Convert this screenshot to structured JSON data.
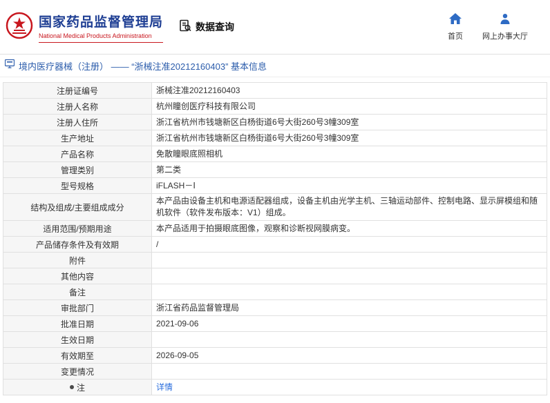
{
  "header": {
    "agency_name_cn": "国家药品监督管理局",
    "agency_name_en": "National Medical Products Administration",
    "section_title": "数据查询",
    "nav": [
      {
        "label": "首页",
        "icon": "home-icon"
      },
      {
        "label": "网上办事大厅",
        "icon": "person-icon"
      }
    ]
  },
  "breadcrumb": {
    "text": "境内医疗器械（注册） ——  “浙械注准20212160403” 基本信息"
  },
  "icons": {
    "emblem": "national-emblem",
    "data_query": "clipboard-search",
    "home": "house",
    "hall": "person",
    "breadcrumb": "monitor",
    "note_dot": "●"
  },
  "colors": {
    "agency_blue": "#1e3e93",
    "agency_red": "#c8161e",
    "breadcrumb_blue": "#2b5cab",
    "link_blue": "#2a6edd",
    "label_bg": "#f6f6f6",
    "border": "#e0e0e0"
  },
  "table": {
    "rows": [
      {
        "label": "注册证编号",
        "value": "浙械注准20212160403"
      },
      {
        "label": "注册人名称",
        "value": "杭州瞳创医疗科技有限公司"
      },
      {
        "label": "注册人住所",
        "value": "浙江省杭州市钱塘新区白杨街道6号大街260号3幢309室"
      },
      {
        "label": "生产地址",
        "value": "浙江省杭州市钱塘新区白杨街道6号大街260号3幢309室"
      },
      {
        "label": "产品名称",
        "value": "免散瞳眼底照相机"
      },
      {
        "label": "管理类别",
        "value": "第二类"
      },
      {
        "label": "型号规格",
        "value": "iFLASH－Ⅰ"
      },
      {
        "label": "结构及组成/主要组成成分",
        "value": "本产品由设备主机和电源适配器组成，设备主机由光学主机、三轴运动部件、控制电路、显示屏模组和随机软件（软件发布版本：V1）组成。"
      },
      {
        "label": "适用范围/预期用途",
        "value": "本产品适用于拍摄眼底图像，观察和诊断视网膜病变。"
      },
      {
        "label": "产品储存条件及有效期",
        "value": "/"
      },
      {
        "label": "附件",
        "value": ""
      },
      {
        "label": "其他内容",
        "value": ""
      },
      {
        "label": "备注",
        "value": ""
      },
      {
        "label": "审批部门",
        "value": "浙江省药品监督管理局"
      },
      {
        "label": "批准日期",
        "value": "2021-09-06"
      },
      {
        "label": "生效日期",
        "value": ""
      },
      {
        "label": "有效期至",
        "value": "2026-09-05"
      },
      {
        "label": "变更情况",
        "value": ""
      },
      {
        "label": "注",
        "value": "详情"
      }
    ]
  }
}
